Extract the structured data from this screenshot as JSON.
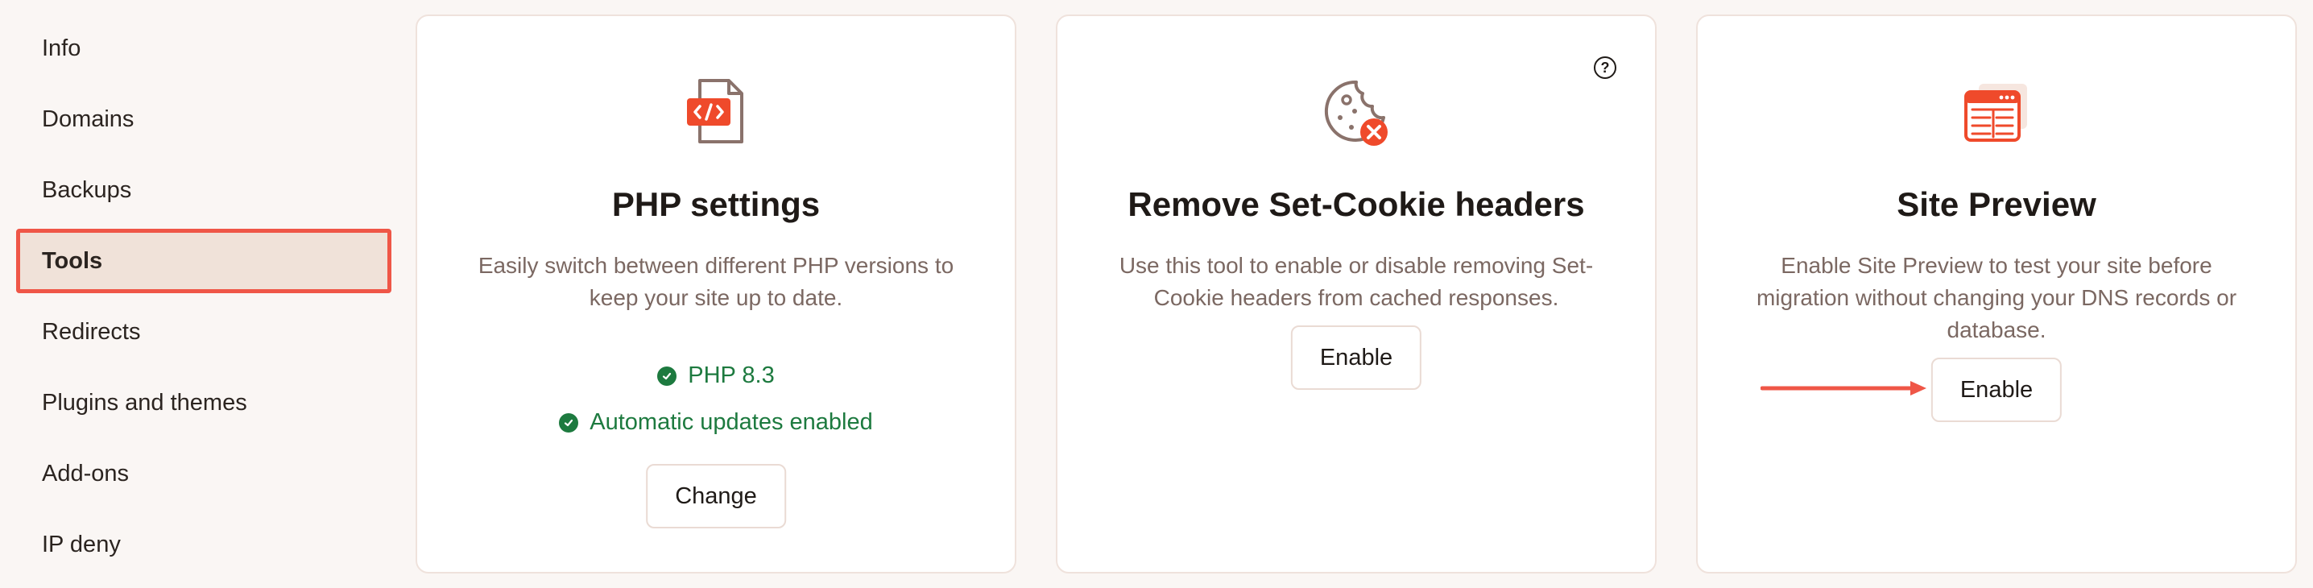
{
  "sidebar": {
    "items": [
      {
        "label": "Info",
        "active": false
      },
      {
        "label": "Domains",
        "active": false
      },
      {
        "label": "Backups",
        "active": false
      },
      {
        "label": "Tools",
        "active": true
      },
      {
        "label": "Redirects",
        "active": false
      },
      {
        "label": "Plugins and themes",
        "active": false
      },
      {
        "label": "Add-ons",
        "active": false
      },
      {
        "label": "IP deny",
        "active": false
      }
    ]
  },
  "cards": {
    "php": {
      "icon": "php-code-file-icon",
      "title": "PHP settings",
      "description": "Easily switch between different PHP versions to keep your site up to date.",
      "status": [
        "PHP 8.3",
        "Automatic updates enabled"
      ],
      "button": "Change"
    },
    "cookie": {
      "icon": "cookie-remove-icon",
      "title": "Remove Set-Cookie headers",
      "description": "Use this tool to enable or disable removing Set-Cookie headers from cached responses.",
      "button": "Enable",
      "help_icon": "?"
    },
    "preview": {
      "icon": "site-preview-window-icon",
      "title": "Site Preview",
      "description": "Enable Site Preview to test your site before migration without changing your DNS records or database.",
      "button": "Enable"
    }
  },
  "colors": {
    "accent": "#ef5647",
    "success": "#1d7a3f",
    "active_bg": "#f0e2d9"
  }
}
